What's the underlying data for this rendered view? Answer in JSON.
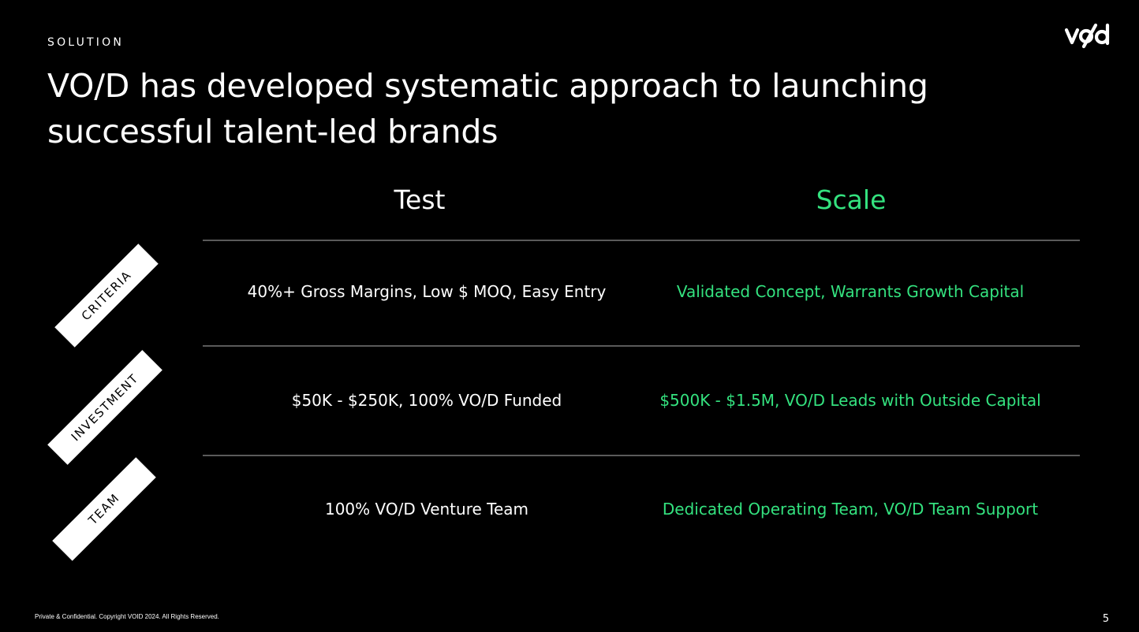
{
  "header": {
    "eyebrow": "SOLUTION",
    "headline": "VO/D has developed systematic approach to launching successful talent-led brands",
    "logo_text": "vo/d"
  },
  "columns": {
    "test": "Test",
    "scale": "Scale"
  },
  "rows": [
    {
      "tag": "CRITERIA",
      "test": "40%+ Gross Margins, Low $ MOQ, Easy Entry",
      "scale": "Validated Concept, Warrants Growth Capital"
    },
    {
      "tag": "INVESTMENT",
      "test": "$50K - $250K, 100% VO/D Funded",
      "scale": "$500K - $1.5M, VO/D Leads with Outside Capital"
    },
    {
      "tag": "TEAM",
      "test": "100% VO/D Venture Team",
      "scale": "Dedicated Operating Team, VO/D Team Support"
    }
  ],
  "footer": {
    "copyright": "Private & Confidential. Copyright VOID 2024. All Rights Reserved.",
    "page_number": "5"
  },
  "colors": {
    "background": "#000000",
    "text": "#ffffff",
    "accent_green": "#34e27f",
    "divider": "#5a5a5a"
  }
}
